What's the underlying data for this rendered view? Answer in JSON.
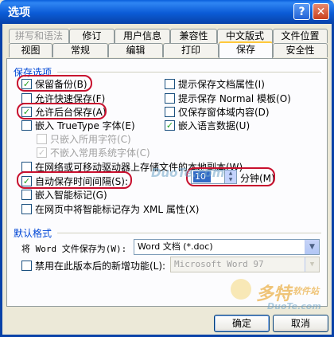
{
  "window": {
    "title": "选项",
    "help": "?",
    "close": "✕"
  },
  "tabs_row1": [
    "拼写和语法",
    "修订",
    "用户信息",
    "兼容性",
    "中文版式",
    "文件位置"
  ],
  "tabs_row2": [
    "视图",
    "常规",
    "编辑",
    "打印",
    "保存",
    "安全性"
  ],
  "save_options": {
    "section_title": "保存选项",
    "keep_backup": "保留备份(B)",
    "allow_fast_save": "允许快速保存(F)",
    "allow_background_save": "允许后台保存(A)",
    "embed_truetype": "嵌入 TrueType 字体(E)",
    "embed_chars_used": "只嵌入所用字符(C)",
    "no_embed_common": "不嵌入常用系统字体(C)",
    "prompt_doc_props": "提示保存文档属性(I)",
    "prompt_normal": "提示保存 Normal 模板(O)",
    "form_data_only": "仅保存窗体域内容(D)",
    "embed_lang_data": "嵌入语言数据(U)",
    "local_copy": "在网络或可移动驱动器上存储文件的本地副本(W)",
    "autosave": "自动保存时间间隔(S):",
    "autosave_minutes": "10",
    "minutes_label": "分钟(M)",
    "embed_smart_tags": "嵌入智能标记(G)",
    "smart_tags_xml": "在网页中将智能标记存为 XML 属性(X)"
  },
  "default_format": {
    "section_title": "默认格式",
    "save_as_label": "将 Word 文件保存为(W):",
    "save_as_value": "Word 文档 (*.doc)",
    "disable_features_label": "禁用在此版本后的新增功能(L):",
    "disable_features_value": "Microsoft Word 97"
  },
  "buttons": {
    "ok": "确定",
    "cancel": "取消"
  },
  "watermark": {
    "brand": "多特",
    "brand_suffix": "软件站",
    "url": "DuoTe.com",
    "url2": "DuoTe.com"
  },
  "colors": {
    "accent": "#0046D5",
    "highlight_ring": "#C8102E",
    "titlebar": "#0A5FDB"
  }
}
